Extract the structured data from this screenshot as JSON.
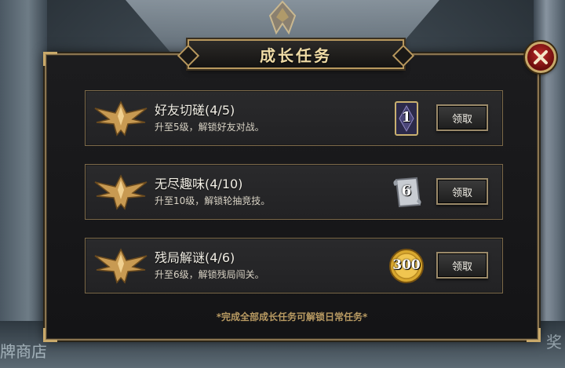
{
  "background": {
    "sign_left": "牌商店",
    "sign_right": "奖"
  },
  "dialog": {
    "title": "成长任务",
    "close_icon": "close-x-icon",
    "footer_note": "*完成全部成长任务可解锁日常任务*",
    "accent_color": "#c9a96a",
    "tasks": [
      {
        "name": "好友切磋(4/5)",
        "desc": "升至5级，解锁好友对战。",
        "reward_icon": "card-pack-icon",
        "reward_value": "1",
        "claim_label": "领取"
      },
      {
        "name": "无尽趣味(4/10)",
        "desc": "升至10级，解锁轮抽竞技。",
        "reward_icon": "scroll-ticket-icon",
        "reward_value": "6",
        "claim_label": "领取"
      },
      {
        "name": "残局解谜(4/6)",
        "desc": "升至6级，解锁残局闯关。",
        "reward_icon": "gold-coin-icon",
        "reward_value": "300",
        "claim_label": "领取"
      }
    ]
  }
}
